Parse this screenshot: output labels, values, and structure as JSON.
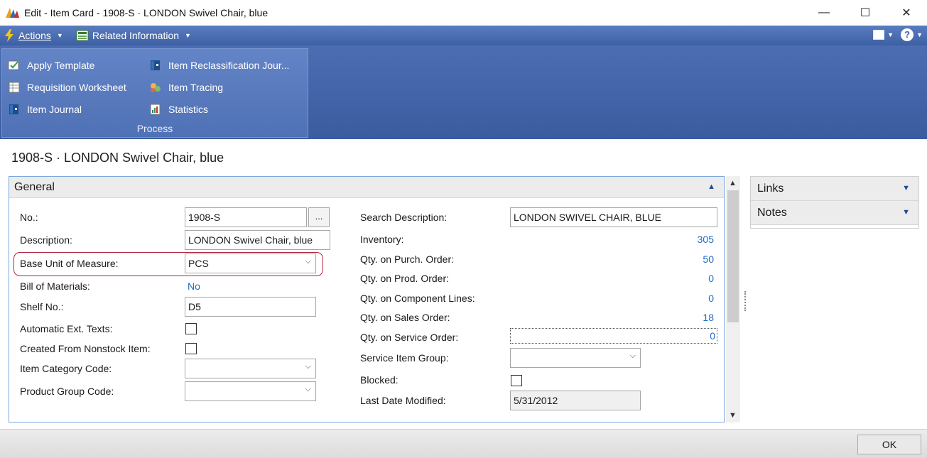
{
  "window": {
    "title": "Edit - Item Card - 1908-S · LONDON Swivel Chair, blue",
    "minimize": "—",
    "maximize": "☐",
    "close": "✕"
  },
  "cmdbar": {
    "actions_label": "Actions",
    "related_label": "Related Information"
  },
  "ribbon": {
    "group_label": "Process",
    "items": [
      {
        "label": "Apply Template",
        "icon": "template-icon"
      },
      {
        "label": "Requisition Worksheet",
        "icon": "worksheet-icon"
      },
      {
        "label": "Item Journal",
        "icon": "journal-icon"
      },
      {
        "label": "Item Reclassification Jour...",
        "icon": "reclass-journal-icon"
      },
      {
        "label": "Item Tracing",
        "icon": "tracing-icon"
      },
      {
        "label": "Statistics",
        "icon": "statistics-icon"
      }
    ]
  },
  "page_title": "1908-S · LONDON Swivel Chair, blue",
  "general": {
    "header": "General",
    "no_label": "No.:",
    "no_value": "1908-S",
    "ellipsis": "...",
    "description_label": "Description:",
    "description_value": "LONDON Swivel Chair, blue",
    "base_uom_label": "Base Unit of Measure:",
    "base_uom_value": "PCS",
    "bom_label": "Bill of Materials:",
    "bom_value": "No",
    "shelf_label": "Shelf No.:",
    "shelf_value": "D5",
    "auto_ext_label": "Automatic Ext. Texts:",
    "auto_ext_checked": false,
    "nonstock_label": "Created From Nonstock Item:",
    "nonstock_checked": false,
    "item_cat_label": "Item Category Code:",
    "item_cat_value": "",
    "prod_group_label": "Product Group Code:",
    "prod_group_value": "",
    "search_desc_label": "Search Description:",
    "search_desc_value": "LONDON SWIVEL CHAIR, BLUE",
    "inventory_label": "Inventory:",
    "inventory_value": "305",
    "purch_label": "Qty. on Purch. Order:",
    "purch_value": "50",
    "prod_label": "Qty. on Prod. Order:",
    "prod_value": "0",
    "component_label": "Qty. on Component Lines:",
    "component_value": "0",
    "sales_label": "Qty. on Sales Order:",
    "sales_value": "18",
    "service_label": "Qty. on Service Order:",
    "service_value": "0",
    "service_group_label": "Service Item Group:",
    "service_group_value": "",
    "blocked_label": "Blocked:",
    "blocked_checked": false,
    "last_modified_label": "Last Date Modified:",
    "last_modified_value": "5/31/2012"
  },
  "factbox": {
    "links_label": "Links",
    "notes_label": "Notes"
  },
  "footer": {
    "ok_label": "OK"
  },
  "colors": {
    "command_bar": "#3d5fa4",
    "link_blue": "#1d6dc4",
    "highlight": "#b0243e"
  }
}
